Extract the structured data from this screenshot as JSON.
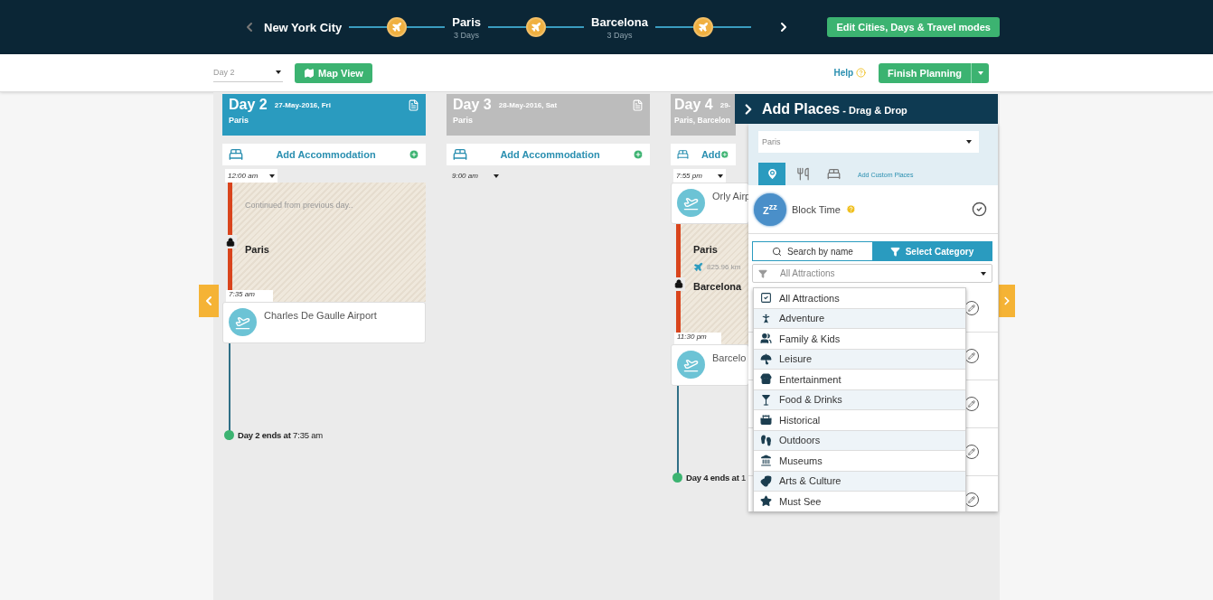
{
  "top_bar": {
    "cities": [
      {
        "name": "New York City"
      },
      {
        "name": "Paris",
        "days": "3 Days"
      },
      {
        "name": "Barcelona",
        "days": "3 Days"
      }
    ],
    "edit_button": "Edit Cities, Days & Travel modes"
  },
  "toolbar": {
    "day_select": "Day 2",
    "map_button": "Map View",
    "help": "Help",
    "finish_button": "Finish Planning"
  },
  "days": [
    {
      "title": "Day 2",
      "date": "27-May-2016, Fri",
      "cities": "Paris",
      "active": true,
      "accommodation": "Add Accommodation",
      "start_time": "12:00 am",
      "events": [
        {
          "kind": "continued",
          "note": "Continued from previous day..",
          "city": "Paris",
          "end_time": "7:35 am"
        },
        {
          "kind": "place",
          "name": "Charles De Gaulle Airport"
        }
      ],
      "end": {
        "label": "Day 2 ends at",
        "time": "7:35 am"
      }
    },
    {
      "title": "Day 3",
      "date": "28-May-2016, Sat",
      "cities": "Paris",
      "active": false,
      "accommodation": "Add Accommodation",
      "start_time": "9:00 am"
    },
    {
      "title": "Day 4",
      "date": "29-",
      "cities": "Paris, Barcelon",
      "active": false,
      "accommodation": "Add",
      "start_time": "7:55 pm",
      "events": [
        {
          "kind": "place",
          "name": "Orly Airp"
        },
        {
          "kind": "travel",
          "from": "Paris",
          "distance": "825.96 km",
          "to": "Barcelona",
          "end_time": "11:30 pm"
        },
        {
          "kind": "place",
          "name": "Barcelo"
        }
      ],
      "end": {
        "label": "Day 4 ends at",
        "time": "1"
      }
    }
  ],
  "add_places": {
    "title": "Add Places",
    "subtitle": " - Drag & Drop",
    "city_select": "Paris",
    "tabs": [
      {
        "selected": true
      },
      {
        "selected": false
      },
      {
        "selected": false
      }
    ],
    "custom_link": "Add Custom Places",
    "block_time": {
      "badge": "Z$^{zz}$",
      "label": "Block Time"
    },
    "search_modes": [
      {
        "label": "Search by name",
        "selected": false
      },
      {
        "label": "Select Category",
        "selected": true
      }
    ],
    "category_select": "All Attractions",
    "category_menu": {
      "all": {
        "label": "All Attractions",
        "checked": true
      },
      "items": [
        "Adventure",
        "Family & Kids",
        "Leisure",
        "Entertainment",
        "Food & Drinks",
        "Historical",
        "Outdoors",
        "Museums",
        "Arts & Culture",
        "Must See"
      ]
    }
  }
}
